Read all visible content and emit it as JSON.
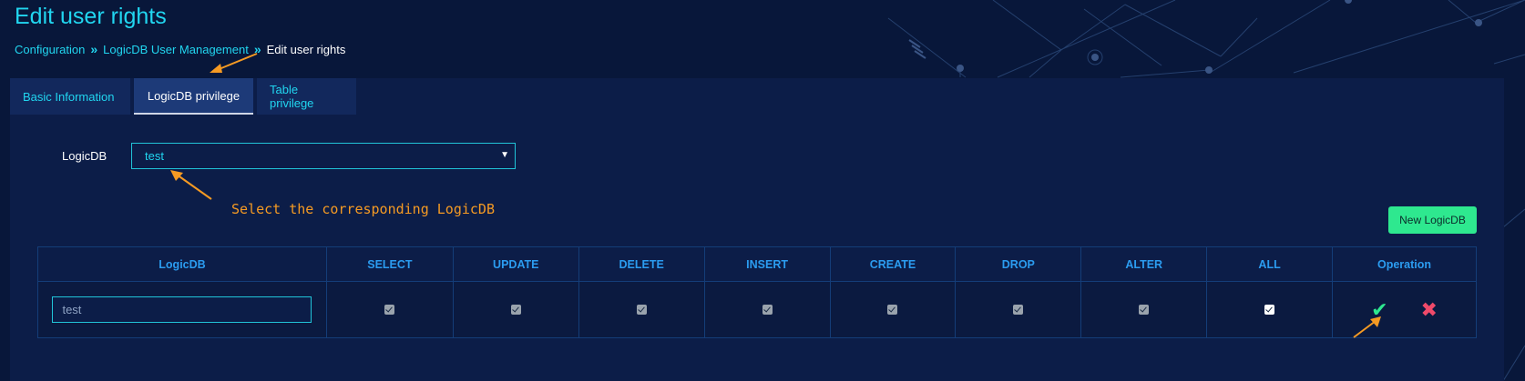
{
  "page": {
    "title": "Edit user rights"
  },
  "breadcrumb": {
    "items": [
      "Configuration",
      "LogicDB User Management",
      "Edit user rights"
    ],
    "separator": "»"
  },
  "tabs": [
    {
      "label": "Basic Information",
      "active": false
    },
    {
      "label": "LogicDB privilege",
      "active": true
    },
    {
      "label": "Table privilege",
      "active": false
    }
  ],
  "form": {
    "logicdb_label": "LogicDB",
    "logicdb_selected": "test"
  },
  "annotation": {
    "text": "Select the corresponding LogicDB"
  },
  "toolbar": {
    "new_logicdb_label": "New LogicDB"
  },
  "table": {
    "columns": [
      "LogicDB",
      "SELECT",
      "UPDATE",
      "DELETE",
      "INSERT",
      "CREATE",
      "DROP",
      "ALTER",
      "ALL",
      "Operation"
    ],
    "rows": [
      {
        "logicdb_value": "test",
        "select": true,
        "update": true,
        "delete": true,
        "insert": true,
        "create": true,
        "drop": true,
        "alter": true,
        "all": true
      }
    ]
  },
  "icons": {
    "save": "check-icon",
    "cancel": "close-icon",
    "select_caret": "caret-down-icon"
  },
  "colors": {
    "background": "#08173a",
    "panel": "#0c1d48",
    "accent_cyan": "#21d6f0",
    "header_blue": "#2b9cf0",
    "button_green": "#2ee88f",
    "cancel_red": "#f04a6a",
    "annotation_orange": "#f59a23"
  }
}
